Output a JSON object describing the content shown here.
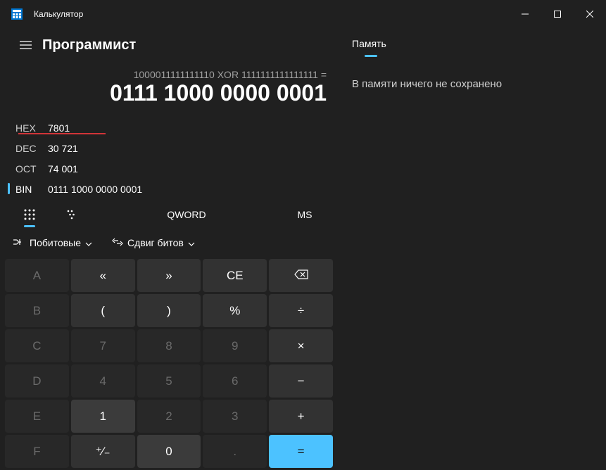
{
  "window": {
    "title": "Калькулятор"
  },
  "header": {
    "mode": "Программист"
  },
  "calc": {
    "expression": "1000011111111110 XOR 1111111111111111 =",
    "display": "0111 1000 0000 0001"
  },
  "bases": {
    "hex": {
      "label": "HEX",
      "value": "7801"
    },
    "dec": {
      "label": "DEC",
      "value": "30 721"
    },
    "oct": {
      "label": "OCT",
      "value": "74 001"
    },
    "bin": {
      "label": "BIN",
      "value": "0111 1000 0000 0001"
    }
  },
  "toolbar": {
    "qword": "QWORD",
    "ms": "MS"
  },
  "dropdowns": {
    "bitwise": "Побитовые",
    "bitshift": "Сдвиг битов"
  },
  "keypad": {
    "row1": [
      "A",
      "«",
      "»",
      "CE",
      "⌫"
    ],
    "row2": [
      "B",
      "(",
      ")",
      "%",
      "÷"
    ],
    "row3": [
      "C",
      "7",
      "8",
      "9",
      "×"
    ],
    "row4": [
      "D",
      "4",
      "5",
      "6",
      "−"
    ],
    "row5": [
      "E",
      "1",
      "2",
      "3",
      "+"
    ],
    "row6": [
      "F",
      "⁺⁄₋",
      "0",
      ".",
      "="
    ]
  },
  "memory": {
    "header": "Память",
    "empty": "В памяти ничего не сохранено"
  }
}
